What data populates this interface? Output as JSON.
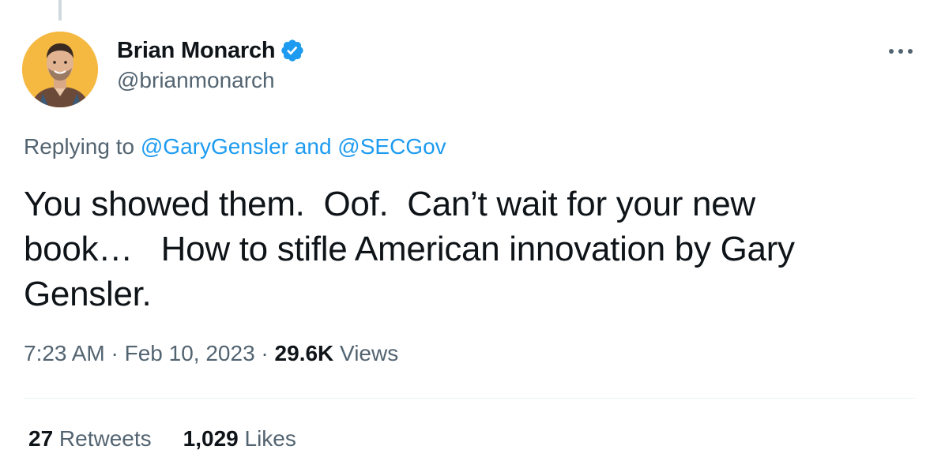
{
  "author": {
    "display_name": "Brian Monarch",
    "handle": "@brianmonarch",
    "verified": true,
    "avatar_icon": "avatar-photo",
    "verified_icon": "verified-badge-icon"
  },
  "more_icon": "more-icon",
  "reply": {
    "prefix": "Replying to ",
    "mention1": "@GaryGensler",
    "joiner": " and ",
    "mention2": "@SECGov"
  },
  "tweet": {
    "text": "You showed them.  Oof.  Can’t wait for your new\nbook…   How to stifle American innovation by Gary\nGensler."
  },
  "meta": {
    "time": "7:23 AM",
    "sep1": " · ",
    "date": "Feb 10, 2023",
    "sep2": " · ",
    "views_count": "29.6K",
    "views_label": " Views"
  },
  "stats": {
    "retweets_count": "27",
    "retweets_label": " Retweets",
    "likes_count": "1,029",
    "likes_label": " Likes"
  },
  "colors": {
    "accent": "#1d9bf0",
    "text": "#0f1419",
    "secondary": "#536471",
    "avatar_bg": "#f5b942"
  }
}
